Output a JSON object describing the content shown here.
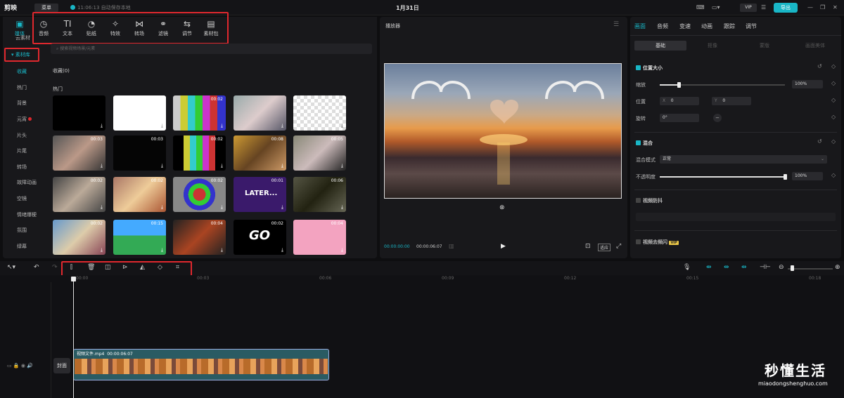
{
  "titlebar": {
    "app_name": "剪映",
    "menu_label": "菜单",
    "autosave_text": "11:06:13 自动保存本地",
    "project_title": "1月31日",
    "vip_label": "VIP",
    "export_label": "导出"
  },
  "toptools": [
    {
      "label": "媒体",
      "icon": "media-icon"
    },
    {
      "label": "音频",
      "icon": "audio-icon"
    },
    {
      "label": "文本",
      "icon": "text-icon"
    },
    {
      "label": "贴纸",
      "icon": "sticker-icon"
    },
    {
      "label": "特效",
      "icon": "effects-icon"
    },
    {
      "label": "转场",
      "icon": "transition-icon"
    },
    {
      "label": "滤镜",
      "icon": "filter-icon"
    },
    {
      "label": "调节",
      "icon": "adjust-icon"
    },
    {
      "label": "素材包",
      "icon": "package-icon"
    }
  ],
  "sidebar": {
    "cloud": "云素材",
    "library": "素材库",
    "items": [
      "收藏",
      "热门",
      "背景",
      "元宵",
      "片头",
      "片尾",
      "转场",
      "故障动画",
      "空镜",
      "情绪爆梗",
      "氛围",
      "绿幕"
    ]
  },
  "search": {
    "placeholder": "搜索视频场景/元素"
  },
  "content": {
    "favorites": "收藏(0)",
    "hot": "热门",
    "thumbs": [
      {
        "dur": ""
      },
      {
        "dur": ""
      },
      {
        "dur": "00:02"
      },
      {
        "dur": ""
      },
      {
        "dur": ""
      },
      {
        "dur": "00:03"
      },
      {
        "dur": "00:03"
      },
      {
        "dur": "00:02"
      },
      {
        "dur": "00:08"
      },
      {
        "dur": "00:05"
      },
      {
        "dur": "00:02"
      },
      {
        "dur": "00:02"
      },
      {
        "dur": "00:02"
      },
      {
        "dur": "00:01"
      },
      {
        "dur": "00:06"
      },
      {
        "dur": "00:02"
      },
      {
        "dur": "00:15"
      },
      {
        "dur": "00:04"
      },
      {
        "dur": "00:02"
      },
      {
        "dur": "00:04"
      }
    ],
    "thumb_texts": [
      "LATER...",
      "GO"
    ]
  },
  "player": {
    "title": "播放器",
    "time_current": "00:00:00:00",
    "time_total": "00:00:06:07",
    "ratio_label": "适应"
  },
  "inspector": {
    "tabs": [
      "画面",
      "音频",
      "变速",
      "动画",
      "跟踪",
      "调节"
    ],
    "subtabs": [
      "基础",
      "抠像",
      "蒙版",
      "画面美体"
    ],
    "position_size": "位置大小",
    "scale_label": "缩放",
    "scale_value": "100%",
    "scale_level": 0.15,
    "position_label": "位置",
    "x_label": "X",
    "x_value": "0",
    "y_label": "Y",
    "y_value": "0",
    "rotate_label": "旋转",
    "rotate_value": "0°",
    "blend_title": "混合",
    "blend_mode_label": "混合模式",
    "blend_mode_value": "正常",
    "opacity_label": "不透明度",
    "opacity_value": "100%",
    "opacity_level": 1.0,
    "stabilize_title": "视频防抖",
    "deflicker_title": "视频去频闪",
    "deflicker_badge": "VIP"
  },
  "timeline": {
    "ticks": [
      "00:00",
      "00:03",
      "00:06",
      "00:09",
      "00:12",
      "00:15",
      "00:18"
    ],
    "clip_name": "视频文件.mp4",
    "clip_duration": "00:00:06:07",
    "cover_label": "封面"
  },
  "watermark": {
    "title": "秒懂生活",
    "url": "miaodongshenghuo.com"
  }
}
